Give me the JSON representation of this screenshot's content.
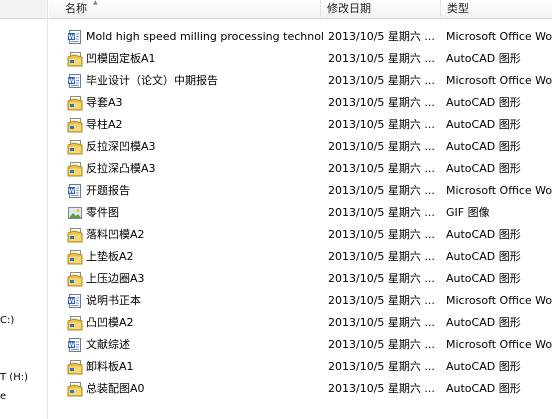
{
  "nav": {
    "items": [
      {
        "label": "C:)"
      },
      {
        "label": "T (H:)"
      },
      {
        "label": "e"
      }
    ]
  },
  "columns": {
    "name": "名称",
    "date": "修改日期",
    "type": "类型"
  },
  "files": [
    {
      "name": "Mold high speed milling processing technology",
      "date": "2013/10/5 星期六 ...",
      "type": "Microsoft Office Wo...",
      "icon": "word-doc-icon"
    },
    {
      "name": "凹模固定板A1",
      "date": "2013/10/5 星期六 ...",
      "type": "AutoCAD 图形",
      "icon": "autocad-drawing-icon"
    },
    {
      "name": "毕业设计（论文）中期报告",
      "date": "2013/10/5 星期六 ...",
      "type": "Microsoft Office Wo...",
      "icon": "word-doc-icon"
    },
    {
      "name": "导套A3",
      "date": "2013/10/5 星期六 ...",
      "type": "AutoCAD 图形",
      "icon": "autocad-drawing-icon"
    },
    {
      "name": "导柱A2",
      "date": "2013/10/5 星期六 ...",
      "type": "AutoCAD 图形",
      "icon": "autocad-drawing-icon"
    },
    {
      "name": "反拉深凹模A3",
      "date": "2013/10/5 星期六 ...",
      "type": "AutoCAD 图形",
      "icon": "autocad-drawing-icon"
    },
    {
      "name": "反拉深凸模A3",
      "date": "2013/10/5 星期六 ...",
      "type": "AutoCAD 图形",
      "icon": "autocad-drawing-icon"
    },
    {
      "name": "开题报告",
      "date": "2013/10/5 星期六 ...",
      "type": "Microsoft Office Wo...",
      "icon": "word-doc-icon"
    },
    {
      "name": "零件图",
      "date": "2013/10/5 星期六 ...",
      "type": "GIF 图像",
      "icon": "gif-image-icon"
    },
    {
      "name": "落料凹模A2",
      "date": "2013/10/5 星期六 ...",
      "type": "AutoCAD 图形",
      "icon": "autocad-drawing-icon"
    },
    {
      "name": "上垫板A2",
      "date": "2013/10/5 星期六 ...",
      "type": "AutoCAD 图形",
      "icon": "autocad-drawing-icon"
    },
    {
      "name": "上压边圈A3",
      "date": "2013/10/5 星期六 ...",
      "type": "AutoCAD 图形",
      "icon": "autocad-drawing-icon"
    },
    {
      "name": "说明书正本",
      "date": "2013/10/5 星期六 ...",
      "type": "Microsoft Office Wo...",
      "icon": "word-doc-icon"
    },
    {
      "name": "凸凹模A2",
      "date": "2013/10/5 星期六 ...",
      "type": "AutoCAD 图形",
      "icon": "autocad-drawing-icon"
    },
    {
      "name": "文献综述",
      "date": "2013/10/5 星期六 ...",
      "type": "Microsoft Office Wo...",
      "icon": "word-doc-icon"
    },
    {
      "name": "卸料板A1",
      "date": "2013/10/5 星期六 ...",
      "type": "AutoCAD 图形",
      "icon": "autocad-drawing-icon"
    },
    {
      "name": "总装配图A0",
      "date": "2013/10/5 星期六 ...",
      "type": "AutoCAD 图形",
      "icon": "autocad-drawing-icon"
    }
  ],
  "colors": {
    "word": "#2a5bb7",
    "autocad_folder": "#e9c24b",
    "gif": "#5b9b3a"
  }
}
